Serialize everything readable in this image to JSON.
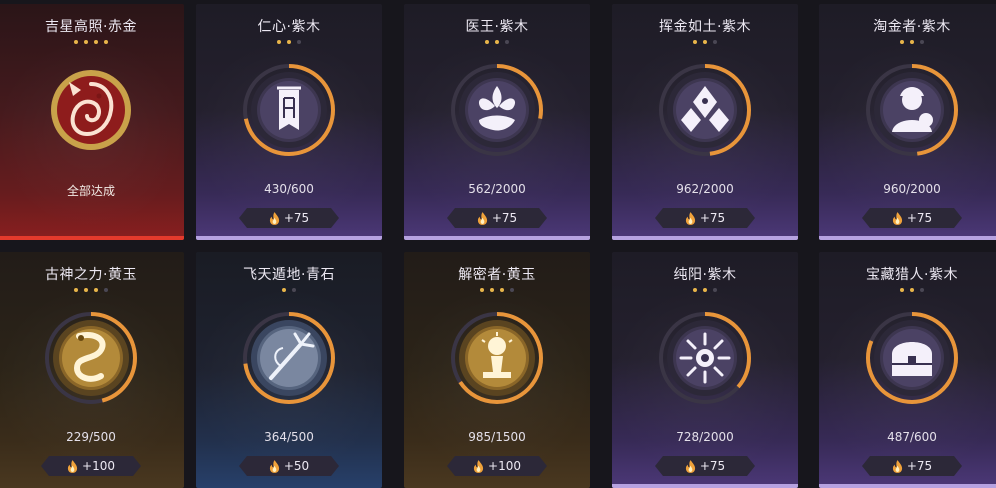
{
  "cards": [
    {
      "title": "吉星高照·赤金",
      "stars_lit": 4,
      "stars_total": 4,
      "progress_text": "",
      "progress": 1.0,
      "status": "全部达成",
      "reward": "",
      "tier_color": "#e43a2c",
      "icon": "koi-fish-icon"
    },
    {
      "title": "仁心·紫木",
      "stars_lit": 2,
      "stars_total": 3,
      "progress_text": "430/600",
      "progress": 0.717,
      "status": "",
      "reward": "+75",
      "tier_color": "#b6a2e0",
      "icon": "banner-icon"
    },
    {
      "title": "医王·紫木",
      "stars_lit": 2,
      "stars_total": 3,
      "progress_text": "562/2000",
      "progress": 0.281,
      "status": "",
      "reward": "+75",
      "tier_color": "#b6a2e0",
      "icon": "lotus-hand-icon"
    },
    {
      "title": "挥金如土·紫木",
      "stars_lit": 2,
      "stars_total": 3,
      "progress_text": "962/2000",
      "progress": 0.481,
      "status": "",
      "reward": "+75",
      "tier_color": "#b6a2e0",
      "icon": "gem-cluster-icon"
    },
    {
      "title": "淘金者·紫木",
      "stars_lit": 2,
      "stars_total": 3,
      "progress_text": "960/2000",
      "progress": 0.48,
      "status": "",
      "reward": "+75",
      "tier_color": "#b6a2e0",
      "icon": "prospector-icon"
    },
    {
      "title": "古神之力·黄玉",
      "stars_lit": 3,
      "stars_total": 4,
      "progress_text": "229/500",
      "progress": 0.458,
      "status": "",
      "reward": "+100",
      "tier_color": "#d9a441",
      "icon": "serpent-icon"
    },
    {
      "title": "飞天遁地·青石",
      "stars_lit": 1,
      "stars_total": 2,
      "progress_text": "364/500",
      "progress": 0.728,
      "status": "",
      "reward": "+50",
      "tier_color": "#6f86b4",
      "icon": "grappling-hook-icon"
    },
    {
      "title": "解密者·黄玉",
      "stars_lit": 3,
      "stars_total": 4,
      "progress_text": "985/1500",
      "progress": 0.657,
      "status": "",
      "reward": "+100",
      "tier_color": "#d9a441",
      "icon": "relic-altar-icon"
    },
    {
      "title": "纯阳·紫木",
      "stars_lit": 2,
      "stars_total": 3,
      "progress_text": "728/2000",
      "progress": 0.364,
      "status": "",
      "reward": "+75",
      "tier_color": "#b6a2e0",
      "icon": "sun-icon"
    },
    {
      "title": "宝藏猎人·紫木",
      "stars_lit": 2,
      "stars_total": 3,
      "progress_text": "487/600",
      "progress": 0.812,
      "status": "",
      "reward": "+75",
      "tier_color": "#b6a2e0",
      "icon": "treasure-chest-icon"
    }
  ]
}
